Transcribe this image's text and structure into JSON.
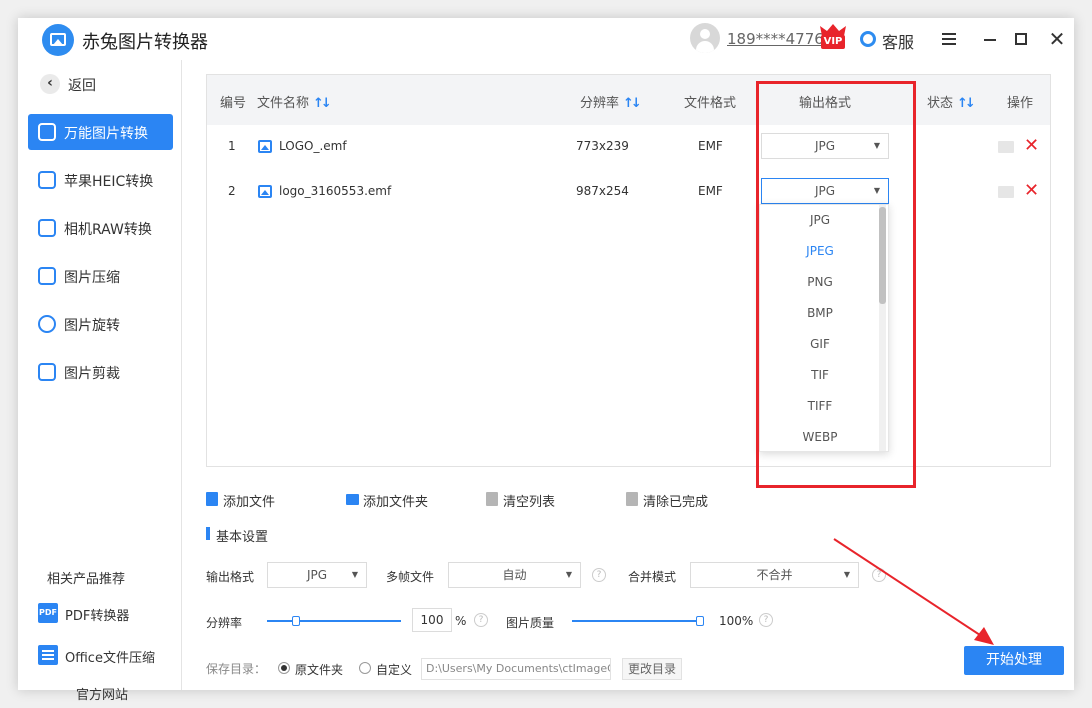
{
  "app": {
    "title": "赤兔图片转换器"
  },
  "user": {
    "phone": "189****4776",
    "vip_label": "VIP"
  },
  "header": {
    "service_label": "客服"
  },
  "sidebar": {
    "back_label": "返回",
    "items": [
      {
        "label": "万能图片转换",
        "active": true
      },
      {
        "label": "苹果HEIC转换"
      },
      {
        "label": "相机RAW转换"
      },
      {
        "label": "图片压缩"
      },
      {
        "label": "图片旋转"
      },
      {
        "label": "图片剪裁"
      }
    ],
    "related_title": "相关产品推荐",
    "related": [
      {
        "icon_text": "PDF",
        "label": "PDF转换器"
      },
      {
        "label": "Office文件压缩"
      }
    ],
    "official_site": "官方网站"
  },
  "table": {
    "headers": {
      "index": "编号",
      "filename": "文件名称",
      "resolution": "分辨率",
      "format": "文件格式",
      "output": "输出格式",
      "status": "状态",
      "action": "操作"
    },
    "rows": [
      {
        "index": "1",
        "filename": "LOGO_.emf",
        "resolution": "773x239",
        "format": "EMF",
        "output": "JPG"
      },
      {
        "index": "2",
        "filename": "logo_3160553.emf",
        "resolution": "987x254",
        "format": "EMF",
        "output": "JPG"
      }
    ]
  },
  "dropdown": {
    "options": [
      "JPG",
      "JPEG",
      "PNG",
      "BMP",
      "GIF",
      "TIF",
      "TIFF",
      "WEBP"
    ],
    "hovered": "JPEG"
  },
  "toolbar": {
    "add_file": "添加文件",
    "add_folder": "添加文件夹",
    "clear_list": "清空列表",
    "clear_done": "清除已完成"
  },
  "settings": {
    "title": "基本设置",
    "output_format_label": "输出格式",
    "output_format_value": "JPG",
    "multiframe_label": "多帧文件",
    "multiframe_value": "自动",
    "merge_label": "合并模式",
    "merge_value": "不合并",
    "resolution_label": "分辨率",
    "resolution_value": "100",
    "percent_sign": "%",
    "quality_label": "图片质量",
    "quality_value": "100%",
    "resolution_level": 0.2,
    "quality_level": 1.0
  },
  "save": {
    "label": "保存目录：",
    "option_original": "原文件夹",
    "option_custom": "自定义",
    "path": "D:\\Users\\My Documents\\ctImageC",
    "change_button": "更改目录"
  },
  "start_button": "开始处理",
  "colors": {
    "accent": "#2b85f3",
    "highlight": "#e8242b"
  }
}
